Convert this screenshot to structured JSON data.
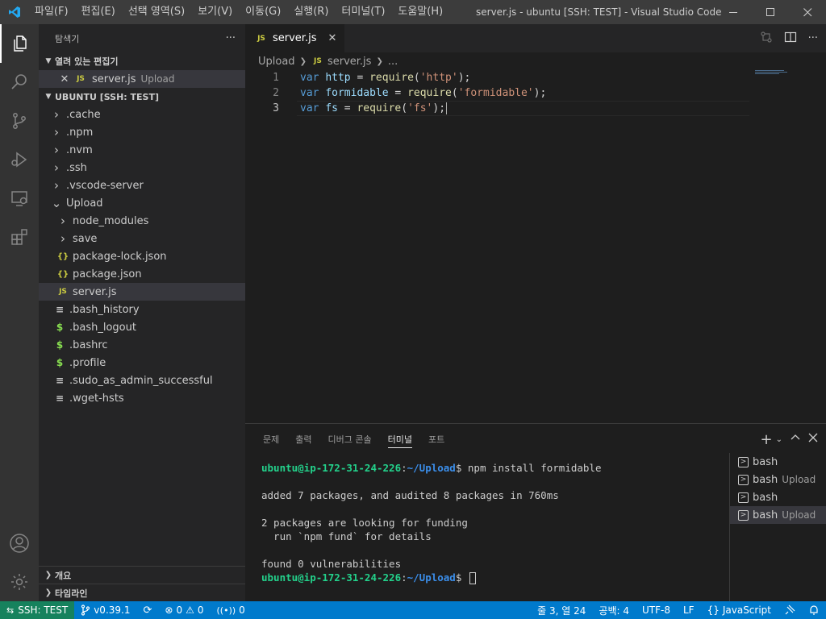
{
  "titlebar": {
    "menus": [
      "파일(F)",
      "편집(E)",
      "선택 영역(S)",
      "보기(V)",
      "이동(G)",
      "실행(R)",
      "터미널(T)",
      "도움말(H)"
    ],
    "title": "server.js - ubuntu [SSH: TEST] - Visual Studio Code",
    "accent": "#3c3c3c"
  },
  "activity": {
    "icons": [
      "explorer-icon",
      "search-icon",
      "source-control-icon",
      "run-debug-icon",
      "remote-explorer-icon",
      "extensions-icon",
      "account-icon",
      "settings-gear-icon"
    ]
  },
  "sidebar": {
    "title": "탐색기",
    "more": "···",
    "open_editors": {
      "label": "열려 있는 편집기",
      "items": [
        {
          "name": "server.js",
          "desc": "Upload",
          "icon": "JS"
        }
      ]
    },
    "workspace": {
      "label": "UBUNTU [SSH: TEST]",
      "tree": [
        {
          "name": ".cache",
          "kind": "folder-closed",
          "level": 0
        },
        {
          "name": ".npm",
          "kind": "folder-closed",
          "level": 0
        },
        {
          "name": ".nvm",
          "kind": "folder-closed",
          "level": 0
        },
        {
          "name": ".ssh",
          "kind": "folder-closed",
          "level": 0
        },
        {
          "name": ".vscode-server",
          "kind": "folder-closed",
          "level": 0
        },
        {
          "name": "Upload",
          "kind": "folder-open",
          "level": 0
        },
        {
          "name": "node_modules",
          "kind": "folder-closed",
          "level": 1
        },
        {
          "name": "save",
          "kind": "folder-closed",
          "level": 1
        },
        {
          "name": "package-lock.json",
          "kind": "json",
          "level": 1
        },
        {
          "name": "package.json",
          "kind": "json",
          "level": 1
        },
        {
          "name": "server.js",
          "kind": "js",
          "level": 1,
          "selected": true
        },
        {
          "name": ".bash_history",
          "kind": "text",
          "level": 0
        },
        {
          "name": ".bash_logout",
          "kind": "shell",
          "level": 0
        },
        {
          "name": ".bashrc",
          "kind": "shell",
          "level": 0
        },
        {
          "name": ".profile",
          "kind": "shell",
          "level": 0
        },
        {
          "name": ".sudo_as_admin_successful",
          "kind": "text",
          "level": 0
        },
        {
          "name": ".wget-hsts",
          "kind": "text",
          "level": 0
        }
      ]
    },
    "outline_label": "개요",
    "timeline_label": "타임라인"
  },
  "editor": {
    "tab": {
      "label": "server.js",
      "icon": "JS"
    },
    "breadcrumb": [
      "Upload",
      "server.js",
      "..."
    ],
    "lines": [
      {
        "num": "1",
        "tokens": [
          [
            "kw",
            "var"
          ],
          [
            "pl",
            " "
          ],
          [
            "var",
            "http"
          ],
          [
            "pl",
            " = "
          ],
          [
            "fn",
            "require"
          ],
          [
            "pl",
            "("
          ],
          [
            "str",
            "'http'"
          ],
          [
            "pl",
            ");"
          ]
        ]
      },
      {
        "num": "2",
        "tokens": [
          [
            "kw",
            "var"
          ],
          [
            "pl",
            " "
          ],
          [
            "var",
            "formidable"
          ],
          [
            "pl",
            " = "
          ],
          [
            "fn",
            "require"
          ],
          [
            "pl",
            "("
          ],
          [
            "str",
            "'formidable'"
          ],
          [
            "pl",
            ");"
          ]
        ]
      },
      {
        "num": "3",
        "tokens": [
          [
            "kw",
            "var"
          ],
          [
            "pl",
            " "
          ],
          [
            "var",
            "fs"
          ],
          [
            "pl",
            " = "
          ],
          [
            "fn",
            "require"
          ],
          [
            "pl",
            "("
          ],
          [
            "str",
            "'fs'"
          ],
          [
            "pl",
            ");"
          ]
        ]
      }
    ],
    "current_line": 3
  },
  "panel": {
    "tabs": [
      "문제",
      "출력",
      "디버그 콘솔",
      "터미널",
      "포트"
    ],
    "active_tab": "터미널",
    "terminal": {
      "user_host": "ubuntu@ip-172-31-24-226",
      "path": "~/Upload",
      "command": "npm install formidable",
      "output": [
        "",
        "added 7 packages, and audited 8 packages in 760ms",
        "",
        "2 packages are looking for funding",
        "  run `npm fund` for details",
        "",
        "found 0 vulnerabilities"
      ]
    },
    "terminals": [
      {
        "name": "bash",
        "desc": ""
      },
      {
        "name": "bash",
        "desc": "Upload"
      },
      {
        "name": "bash",
        "desc": ""
      },
      {
        "name": "bash",
        "desc": "Upload",
        "selected": true
      }
    ]
  },
  "statusbar": {
    "remote": "SSH: TEST",
    "branch": "v0.39.1",
    "errors": "0",
    "warnings": "0",
    "ports": "0",
    "position": "줄 3, 열 24",
    "spaces": "공백: 4",
    "encoding": "UTF-8",
    "eol": "LF",
    "language": "JavaScript",
    "color": "#007acc"
  }
}
